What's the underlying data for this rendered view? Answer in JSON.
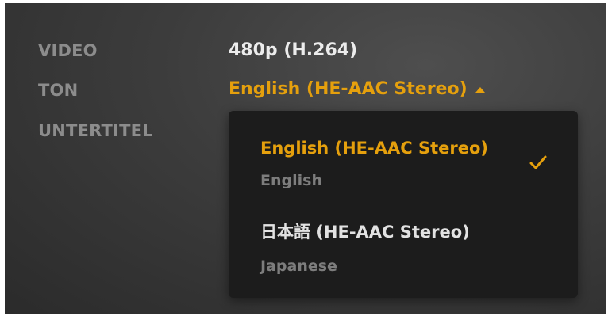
{
  "settings": {
    "video": {
      "label": "VIDEO",
      "value": "480p (H.264)"
    },
    "audio": {
      "label": "TON",
      "value": "English (HE-AAC Stereo)"
    },
    "subtitles": {
      "label": "UNTERTITEL"
    }
  },
  "audio_menu": {
    "options": [
      {
        "title": "English (HE-AAC Stereo)",
        "subtitle": "English",
        "selected": true
      },
      {
        "title": "日本語 (HE-AAC Stereo)",
        "subtitle": "Japanese",
        "selected": false
      }
    ]
  },
  "icons": {
    "caret": "caret-up-icon",
    "selected": "checkmark-icon"
  },
  "colors": {
    "accent": "#e5a00d",
    "label": "#8c8c8c",
    "value": "#ececec",
    "menu_bg": "#1c1c1c"
  }
}
